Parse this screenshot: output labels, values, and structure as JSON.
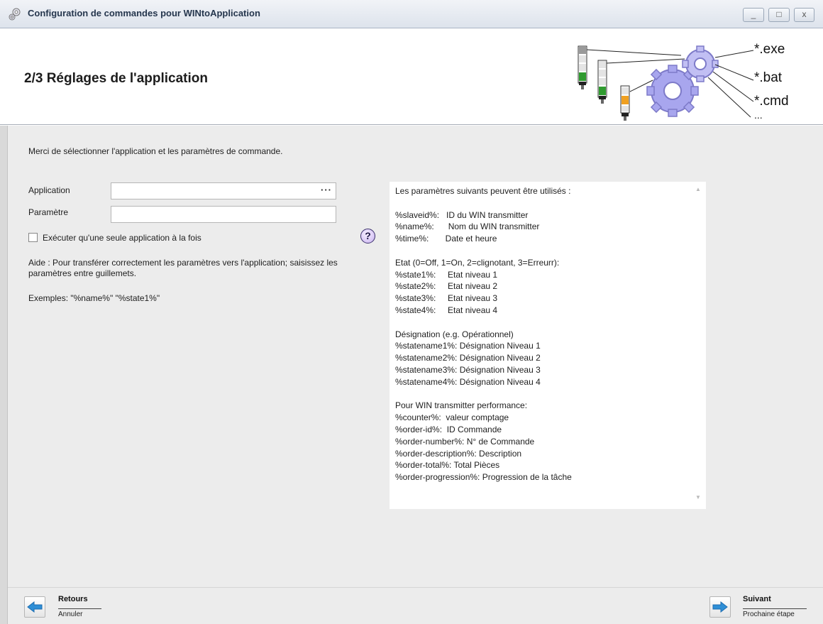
{
  "window": {
    "title": "Configuration de commandes pour WINtoApplication",
    "buttons": {
      "minimize": "_",
      "maximize": "□",
      "close": "x"
    }
  },
  "header": {
    "title": "2/3 Réglages de l'application",
    "banner_extensions": [
      "*.exe",
      "*.bat",
      "*.cmd",
      "..."
    ]
  },
  "main": {
    "intro": "Merci de sélectionner l'application et les paramètres de commande.",
    "application_label": "Application",
    "application_value": "",
    "browse_label": "···",
    "parameter_label": "Paramètre",
    "parameter_value": "",
    "single_instance_label": "Exécuter qu'une seule application à la fois",
    "single_instance_checked": false,
    "help_icon_glyph": "?",
    "help_text": "Aide : Pour transférer correctement les paramètres vers l'application; saisissez les paramètres entre guillemets.",
    "examples": "Exemples: \"%name%\" \"%state1%\""
  },
  "params_panel": {
    "text": "Les paramètres suivants peuvent être utilisés :\n\n%slaveid%:   ID du WIN transmitter\n%name%:      Nom du WIN transmitter\n%time%:       Date et heure\n\nEtat (0=Off, 1=On, 2=clignotant, 3=Erreurr):\n%state1%:     Etat niveau 1\n%state2%:     Etat niveau 2\n%state3%:     Etat niveau 3\n%state4%:     Etat niveau 4\n\nDésignation (e.g. Opérationnel)\n%statename1%: Désignation Niveau 1\n%statename2%: Désignation Niveau 2\n%statename3%: Désignation Niveau 3\n%statename4%: Désignation Niveau 4\n\nPour WIN transmitter performance:\n%counter%:  valeur comptage\n%order-id%:  ID Commande\n%order-number%: N° de Commande\n%order-description%: Description\n%order-total%: Total Pièces\n%order-progression%: Progression de la tâche"
  },
  "footer": {
    "back_label": "Retours",
    "back_sub": "Annuler",
    "next_label": "Suivant",
    "next_sub": "Prochaine étape"
  },
  "colors": {
    "arrow_blue": "#2f8fd6",
    "gear": "#a8a6ee",
    "background": "#ececec"
  }
}
